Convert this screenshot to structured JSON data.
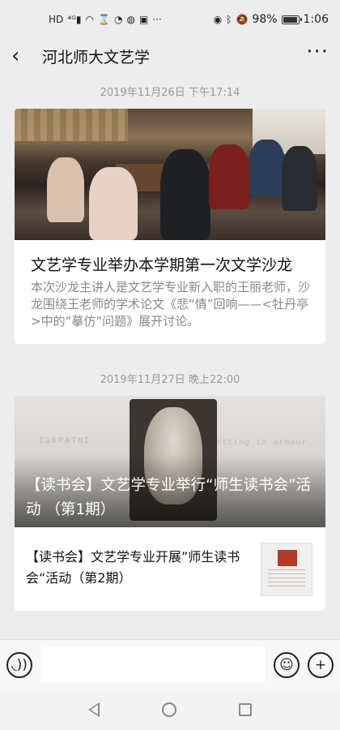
{
  "status_bar": {
    "battery": "98%",
    "time": "1:06",
    "left_icons": [
      "hd-icon",
      "signal-4g-icon",
      "wifi-icon",
      "hourglass-icon",
      "app-icon",
      "wechat-icon",
      "notification-icon"
    ],
    "right_icons": [
      "eye-icon",
      "bluetooth-icon",
      "mute-icon"
    ]
  },
  "nav": {
    "title": "河北师大文艺学",
    "back_icon": "chevron-left-icon",
    "more_icon": "more-dots-icon"
  },
  "messages": [
    {
      "timestamp": "2019年11月26日 下午17:14",
      "title": "文艺学专业举办本学期第一次文学沙龙",
      "description": "本次沙龙主讲人是文艺学专业新入职的王丽老师，沙龙围绕王老师的学术论文《悲“情”回响——<牡丹亭>中的“摹仿”问题》展开讨论。"
    },
    {
      "timestamp": "2019年11月27日 晚上22:00",
      "title": "【读书会】文艺学专业举行“师生读书会”活动 （第1期）",
      "sub_article": "【读书会】文艺学专业开展”师生读书会“活动（第2期）"
    }
  ],
  "input_bar": {
    "voice_icon": "voice-icon",
    "emoji_icon": "emoji-icon",
    "add_icon": "plus-icon",
    "placeholder": ""
  },
  "colors": {
    "background": "#ededed",
    "card": "#ffffff",
    "timestamp": "#999999",
    "desc": "#888888"
  }
}
